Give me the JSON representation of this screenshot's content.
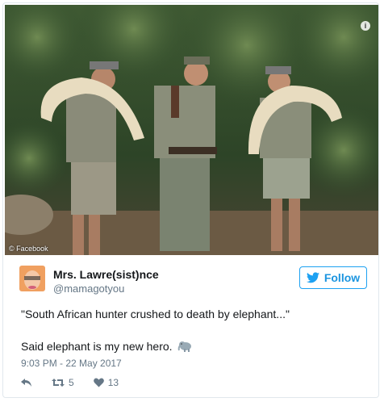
{
  "photo": {
    "credit": "© Facebook",
    "info_label": "i"
  },
  "author": {
    "name": "Mrs. Lawre(sist)nce",
    "handle": "@mamagotyou"
  },
  "follow": {
    "label": "Follow",
    "icon": "twitter-bird-icon",
    "color": "#1da1f2"
  },
  "tweet": {
    "line1": "\"South African hunter crushed to death by elephant...\"",
    "line2": "Said elephant is my new hero.",
    "emoji": "elephant-emoji",
    "timestamp": "9:03 PM - 22 May 2017"
  },
  "actions": {
    "reply_icon": "reply-icon",
    "retweet_icon": "retweet-icon",
    "retweet_count": "5",
    "like_icon": "heart-icon",
    "like_count": "13"
  }
}
